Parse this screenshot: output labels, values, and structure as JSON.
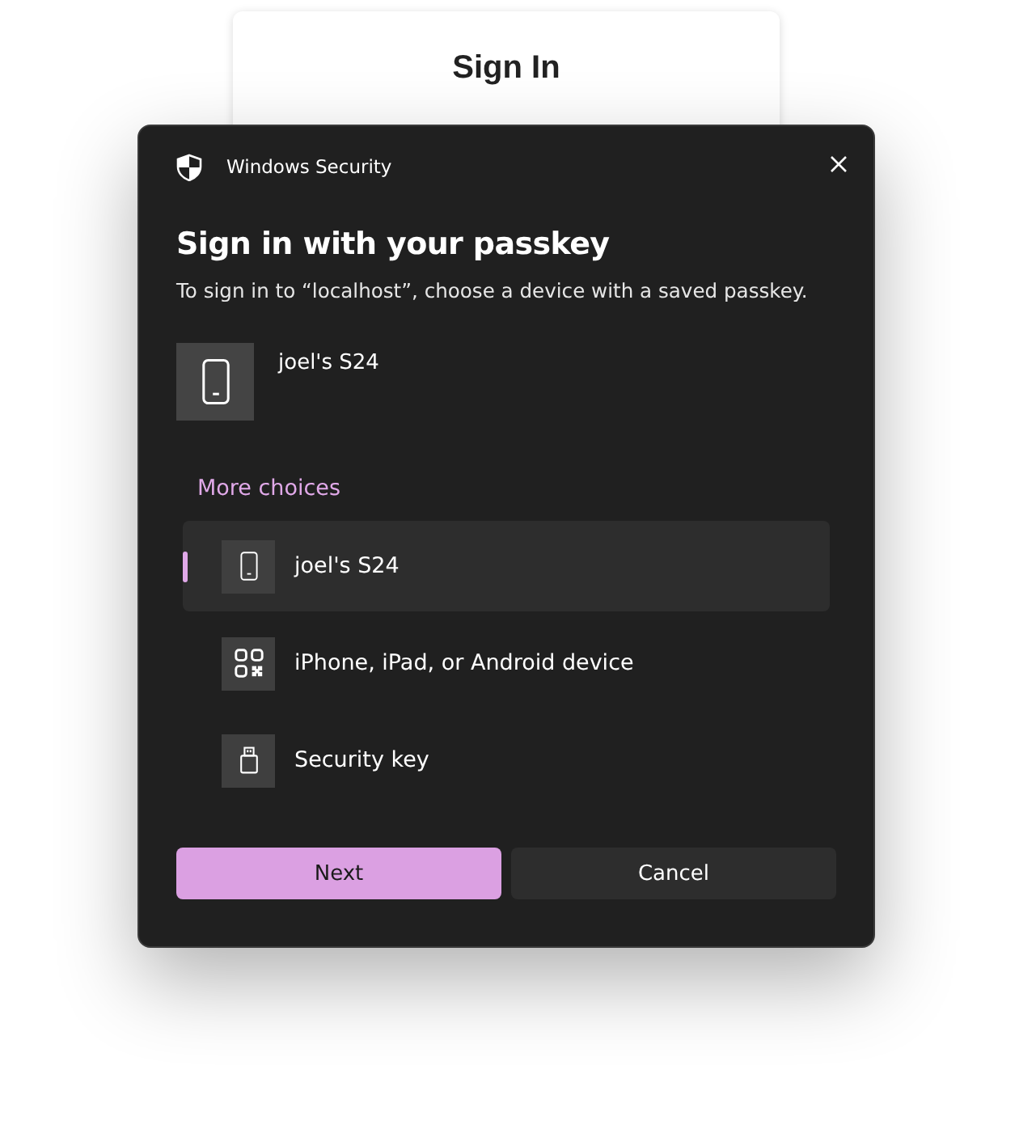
{
  "background_page": {
    "title": "Sign In"
  },
  "dialog": {
    "title": "Windows Security",
    "heading": "Sign in with your passkey",
    "description": "To sign in to “localhost”, choose a device with a saved passkey.",
    "device": {
      "kind": "phone",
      "name": "joel's S24"
    },
    "more_choices": "More choices",
    "options": [
      {
        "kind": "phone",
        "label": "joel's S24",
        "selected": true
      },
      {
        "kind": "qr",
        "label": "iPhone, iPad, or Android device",
        "selected": false
      },
      {
        "kind": "usb",
        "label": "Security key",
        "selected": false
      }
    ],
    "buttons": [
      {
        "label": "Next",
        "kind": "primary"
      },
      {
        "label": "Cancel",
        "kind": "secondary"
      }
    ]
  }
}
